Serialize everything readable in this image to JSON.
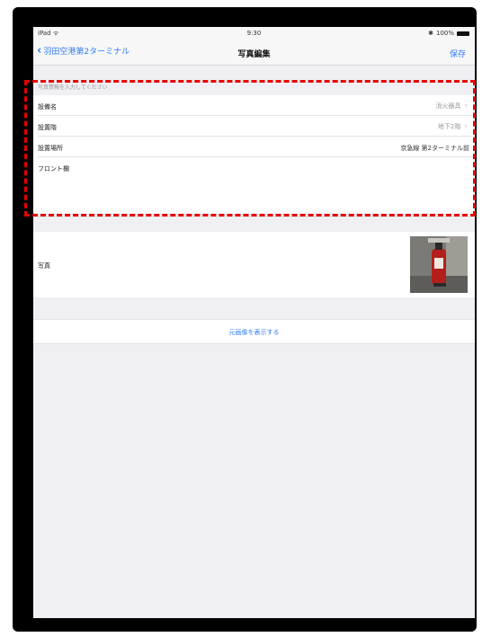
{
  "status": {
    "device": "iPad",
    "time": "9:30",
    "battery": "100%"
  },
  "nav": {
    "back_label": "羽田空港第2ターミナル",
    "title": "写真編集",
    "save_label": "保存"
  },
  "form": {
    "section_header": "写真情報を入力してください",
    "rows": [
      {
        "label": "設備名",
        "value": "消火器具"
      },
      {
        "label": "設置階",
        "value": "地下2階"
      },
      {
        "label": "設置場所",
        "value": "京急線 第2ターミナル前"
      },
      {
        "label": "フロント欄",
        "value": ""
      }
    ]
  },
  "photo": {
    "label": "写真"
  },
  "show_image_link": "元画像を表示する",
  "colors": {
    "accent": "#2f7cf6",
    "highlight": "#e60000"
  }
}
